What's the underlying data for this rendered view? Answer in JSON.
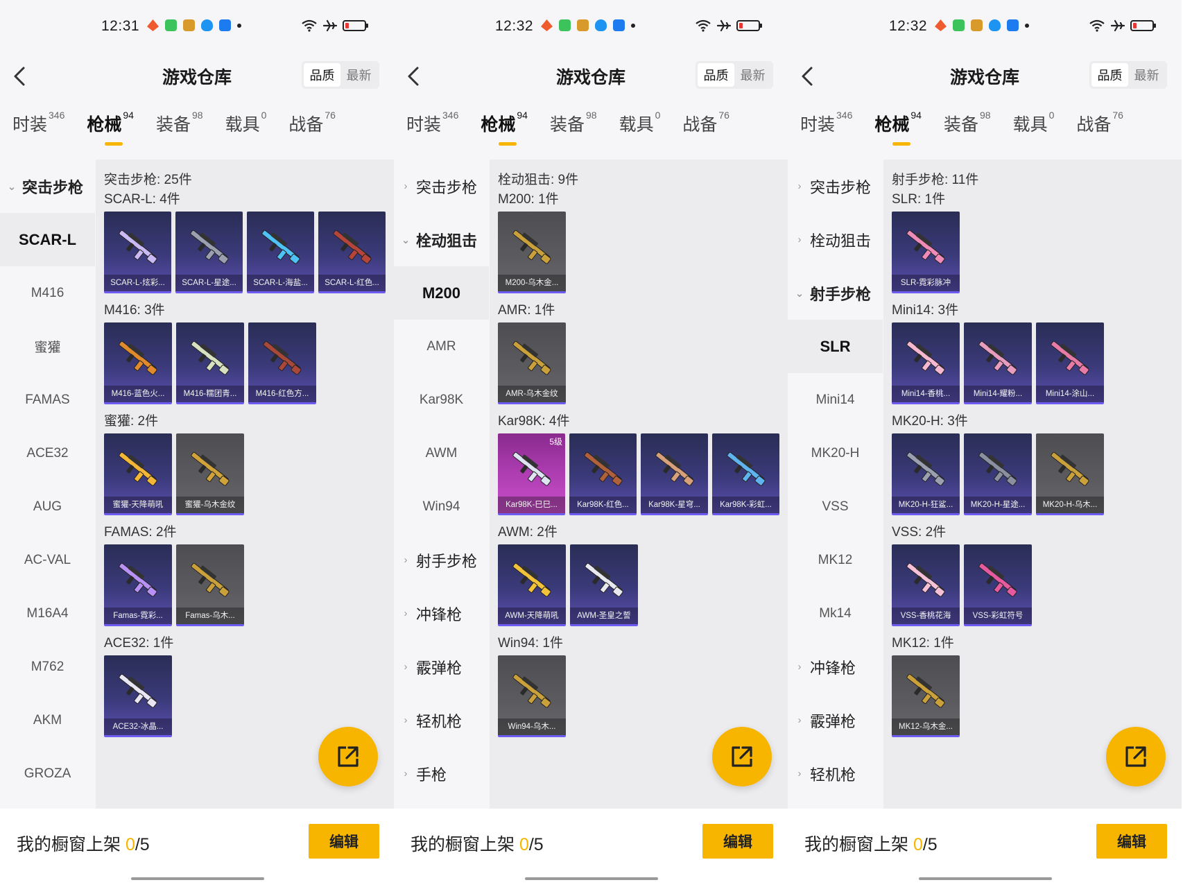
{
  "colors": {
    "accent": "#f7b500",
    "card_purple": "#3b3a7a",
    "card_gray": "#5c5c60",
    "card_pink": "#b13fb4"
  },
  "panels": [
    {
      "status": {
        "time": "12:31"
      },
      "header": {
        "title": "游戏仓库",
        "sort_quality": "品质",
        "sort_newest": "最新"
      },
      "tabs": [
        {
          "label": "时装",
          "count": "346"
        },
        {
          "label": "枪械",
          "count": "94",
          "active": true
        },
        {
          "label": "装备",
          "count": "98"
        },
        {
          "label": "载具",
          "count": "0"
        },
        {
          "label": "战备",
          "count": "76"
        }
      ],
      "sidebar": [
        {
          "label": "突击步枪",
          "type": "group",
          "open": true
        },
        {
          "label": "SCAR-L",
          "type": "sub",
          "active": true
        },
        {
          "label": "M416",
          "type": "sub"
        },
        {
          "label": "蜜獾",
          "type": "sub"
        },
        {
          "label": "FAMAS",
          "type": "sub"
        },
        {
          "label": "ACE32",
          "type": "sub"
        },
        {
          "label": "AUG",
          "type": "sub"
        },
        {
          "label": "AC-VAL",
          "type": "sub"
        },
        {
          "label": "M16A4",
          "type": "sub"
        },
        {
          "label": "M762",
          "type": "sub"
        },
        {
          "label": "AKM",
          "type": "sub"
        },
        {
          "label": "GROZA",
          "type": "sub"
        }
      ],
      "section_title": "突击步枪: 25件",
      "groups": [
        {
          "title": "SCAR-L: 4件",
          "items": [
            {
              "name": "SCAR-L-炫彩...",
              "style": "purple",
              "gun": "#c9b9f5"
            },
            {
              "name": "SCAR-L-星途...",
              "style": "purple",
              "gun": "#9aa0b0"
            },
            {
              "name": "SCAR-L-海盐...",
              "style": "purple",
              "gun": "#4fc3f7"
            },
            {
              "name": "SCAR-L-红色...",
              "style": "purple",
              "gun": "#b5453a"
            }
          ]
        },
        {
          "title": "M416: 3件",
          "items": [
            {
              "name": "M416-蓝色火...",
              "style": "purple",
              "gun": "#e08a2c"
            },
            {
              "name": "M416-糯团青...",
              "style": "purple",
              "gun": "#d7e0c0"
            },
            {
              "name": "M416-红色方...",
              "style": "purple",
              "gun": "#a9473b"
            }
          ]
        },
        {
          "title": "蜜獾: 2件",
          "items": [
            {
              "name": "蜜獾-天降萌吼",
              "style": "purple",
              "gun": "#f4b637"
            },
            {
              "name": "蜜獾-乌木金纹",
              "style": "gray",
              "gun": "#d0a23a"
            }
          ]
        },
        {
          "title": "FAMAS: 2件",
          "items": [
            {
              "name": "Famas-霓彩...",
              "style": "purple",
              "gun": "#b990f5"
            },
            {
              "name": "Famas-乌木...",
              "style": "gray",
              "gun": "#c9a03a"
            }
          ]
        },
        {
          "title": "ACE32: 1件",
          "items": [
            {
              "name": "ACE32-冰晶...",
              "style": "purple",
              "gun": "#e8e6f5"
            }
          ]
        }
      ],
      "shelf": {
        "label": "我的橱窗上架 ",
        "current": "0",
        "total": "/5"
      },
      "edit_label": "编辑"
    },
    {
      "status": {
        "time": "12:32"
      },
      "header": {
        "title": "游戏仓库",
        "sort_quality": "品质",
        "sort_newest": "最新"
      },
      "tabs": [
        {
          "label": "时装",
          "count": "346"
        },
        {
          "label": "枪械",
          "count": "94",
          "active": true
        },
        {
          "label": "装备",
          "count": "98"
        },
        {
          "label": "载具",
          "count": "0"
        },
        {
          "label": "战备",
          "count": "76"
        }
      ],
      "sidebar": [
        {
          "label": "突击步枪",
          "type": "group",
          "open": false
        },
        {
          "label": "栓动狙击",
          "type": "group",
          "open": true
        },
        {
          "label": "M200",
          "type": "sub",
          "active": true
        },
        {
          "label": "AMR",
          "type": "sub"
        },
        {
          "label": "Kar98K",
          "type": "sub"
        },
        {
          "label": "AWM",
          "type": "sub"
        },
        {
          "label": "Win94",
          "type": "sub"
        },
        {
          "label": "射手步枪",
          "type": "group",
          "open": false
        },
        {
          "label": "冲锋枪",
          "type": "group",
          "open": false
        },
        {
          "label": "霰弹枪",
          "type": "group",
          "open": false
        },
        {
          "label": "轻机枪",
          "type": "group",
          "open": false
        },
        {
          "label": "手枪",
          "type": "group",
          "open": false
        }
      ],
      "section_title": "栓动狙击: 9件",
      "groups": [
        {
          "title": "M200: 1件",
          "items": [
            {
              "name": "M200-乌木金...",
              "style": "gray",
              "gun": "#c9a03a"
            }
          ]
        },
        {
          "title": "AMR: 1件",
          "items": [
            {
              "name": "AMR-乌木金纹",
              "style": "gray",
              "gun": "#c9a03a"
            }
          ]
        },
        {
          "title": "Kar98K: 4件",
          "items": [
            {
              "name": "Kar98K-巳巳...",
              "style": "pink",
              "gun": "#dfe4f2",
              "level": "5级"
            },
            {
              "name": "Kar98K-红色...",
              "style": "purple",
              "gun": "#b0603a"
            },
            {
              "name": "Kar98K-星穹...",
              "style": "purple",
              "gun": "#d7a07a"
            },
            {
              "name": "Kar98K-彩虹...",
              "style": "purple",
              "gun": "#5fb4f0"
            }
          ]
        },
        {
          "title": "AWM: 2件",
          "items": [
            {
              "name": "AWM-天降萌吼",
              "style": "purple",
              "gun": "#f2c23a"
            },
            {
              "name": "AWM-圣皇之誓",
              "style": "purple",
              "gun": "#e8e8f0"
            }
          ]
        },
        {
          "title": "Win94: 1件",
          "items": [
            {
              "name": "Win94-乌木...",
              "style": "gray",
              "gun": "#c9a03a"
            }
          ]
        }
      ],
      "shelf": {
        "label": "我的橱窗上架 ",
        "current": "0",
        "total": "/5"
      },
      "edit_label": "编辑"
    },
    {
      "status": {
        "time": "12:32"
      },
      "header": {
        "title": "游戏仓库",
        "sort_quality": "品质",
        "sort_newest": "最新"
      },
      "tabs": [
        {
          "label": "时装",
          "count": "346"
        },
        {
          "label": "枪械",
          "count": "94",
          "active": true
        },
        {
          "label": "装备",
          "count": "98"
        },
        {
          "label": "载具",
          "count": "0"
        },
        {
          "label": "战备",
          "count": "76"
        }
      ],
      "sidebar": [
        {
          "label": "突击步枪",
          "type": "group",
          "open": false
        },
        {
          "label": "栓动狙击",
          "type": "group",
          "open": false
        },
        {
          "label": "射手步枪",
          "type": "group",
          "open": true
        },
        {
          "label": "SLR",
          "type": "sub",
          "active": true
        },
        {
          "label": "Mini14",
          "type": "sub"
        },
        {
          "label": "MK20-H",
          "type": "sub"
        },
        {
          "label": "VSS",
          "type": "sub"
        },
        {
          "label": "MK12",
          "type": "sub"
        },
        {
          "label": "Mk14",
          "type": "sub"
        },
        {
          "label": "冲锋枪",
          "type": "group",
          "open": false
        },
        {
          "label": "霰弹枪",
          "type": "group",
          "open": false
        },
        {
          "label": "轻机枪",
          "type": "group",
          "open": false
        }
      ],
      "section_title": "射手步枪: 11件",
      "groups": [
        {
          "title": "SLR: 1件",
          "items": [
            {
              "name": "SLR-霓彩脉冲",
              "style": "purple",
              "gun": "#f08ab8"
            }
          ]
        },
        {
          "title": "Mini14: 3件",
          "items": [
            {
              "name": "Mini14-香桃...",
              "style": "purple",
              "gun": "#f5b8d0"
            },
            {
              "name": "Mini14-耀粉...",
              "style": "purple",
              "gun": "#e89cc0"
            },
            {
              "name": "Mini14-涂山...",
              "style": "purple",
              "gun": "#e87aa8"
            }
          ]
        },
        {
          "title": "MK20-H: 3件",
          "items": [
            {
              "name": "MK20-H-狂鲨...",
              "style": "purple",
              "gun": "#9aa0b0"
            },
            {
              "name": "MK20-H-星途...",
              "style": "purple",
              "gun": "#8a90a0"
            },
            {
              "name": "MK20-H-乌木...",
              "style": "gray",
              "gun": "#c9a03a"
            }
          ]
        },
        {
          "title": "VSS: 2件",
          "items": [
            {
              "name": "VSS-香桃花海",
              "style": "purple",
              "gun": "#f5c0d8"
            },
            {
              "name": "VSS-彩虹符号",
              "style": "purple",
              "gun": "#e85aa0"
            }
          ]
        },
        {
          "title": "MK12: 1件",
          "items": [
            {
              "name": "MK12-乌木金...",
              "style": "gray",
              "gun": "#c9a03a"
            }
          ]
        }
      ],
      "shelf": {
        "label": "我的橱窗上架 ",
        "current": "0",
        "total": "/5"
      },
      "edit_label": "编辑"
    }
  ]
}
